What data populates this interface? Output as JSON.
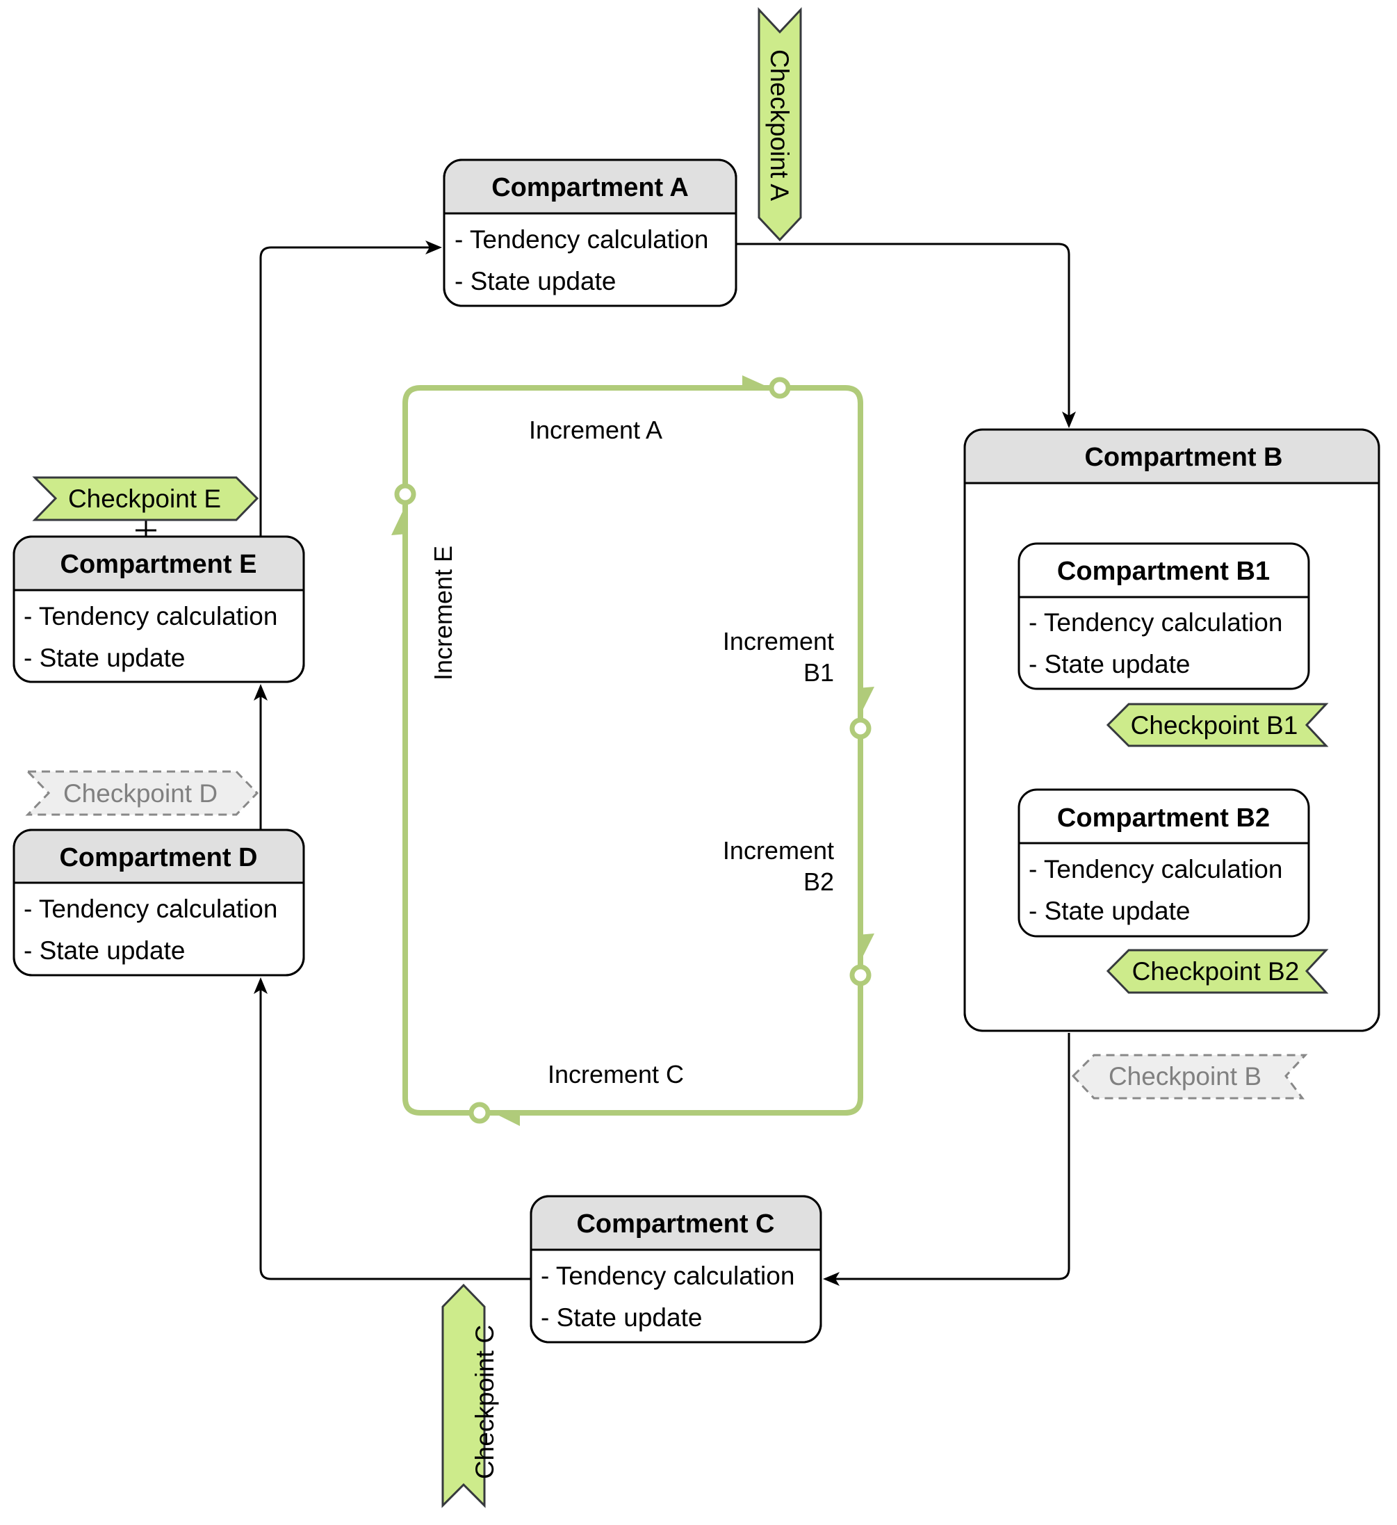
{
  "diagram": {
    "colors": {
      "checkpoint_active_fill": "#cdeb8b",
      "checkpoint_inactive_fill": "#eeeeee",
      "increment_loop": "#b0cb7a",
      "header_fill": "#e0e0e0"
    },
    "compartments": {
      "a": {
        "title": "Compartment A",
        "items": [
          "- Tendency calculation",
          "- State update"
        ]
      },
      "b": {
        "title": "Compartment B"
      },
      "b1": {
        "title": "Compartment B1",
        "items": [
          "- Tendency calculation",
          "- State update"
        ]
      },
      "b2": {
        "title": "Compartment B2",
        "items": [
          "- Tendency calculation",
          "- State update"
        ]
      },
      "c": {
        "title": "Compartment C",
        "items": [
          "- Tendency calculation",
          "- State update"
        ]
      },
      "d": {
        "title": "Compartment D",
        "items": [
          "- Tendency calculation",
          "- State update"
        ]
      },
      "e": {
        "title": "Compartment E",
        "items": [
          "- Tendency calculation",
          "- State update"
        ]
      }
    },
    "checkpoints": {
      "a": {
        "label": "Checkpoint A",
        "state": "active"
      },
      "b": {
        "label": "Checkpoint B",
        "state": "inactive"
      },
      "b1": {
        "label": "Checkpoint B1",
        "state": "active"
      },
      "b2": {
        "label": "Checkpoint B2",
        "state": "active"
      },
      "c": {
        "label": "Checkpoint C",
        "state": "active"
      },
      "d": {
        "label": "Checkpoint D",
        "state": "inactive"
      },
      "e": {
        "label": "Checkpoint E",
        "state": "active"
      }
    },
    "increments": {
      "a": {
        "label": "Increment A"
      },
      "b1": {
        "label_line1": "Increment",
        "label_line2": "B1"
      },
      "b2": {
        "label_line1": "Increment",
        "label_line2": "B2"
      },
      "c": {
        "label": "Increment C"
      },
      "e": {
        "label": "Increment E"
      }
    }
  }
}
